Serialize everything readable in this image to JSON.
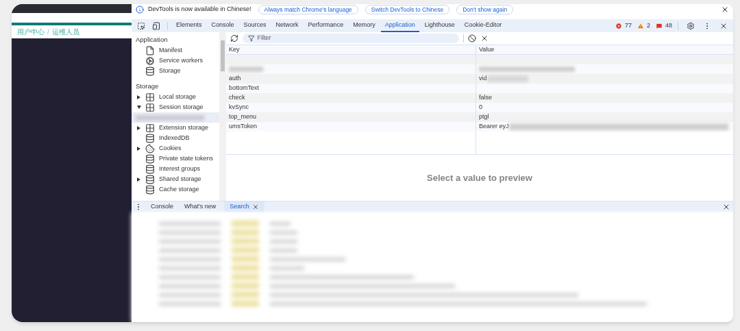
{
  "page": {
    "breadcrumb": [
      "用户中心",
      "运维人员"
    ],
    "separator": "/"
  },
  "infobar": {
    "message": "DevTools is now available in Chinese!",
    "buttons": [
      "Always match Chrome's language",
      "Switch DevTools to Chinese",
      "Don't show again"
    ]
  },
  "tabs": [
    {
      "label": "Elements",
      "selected": false
    },
    {
      "label": "Console",
      "selected": false
    },
    {
      "label": "Sources",
      "selected": false
    },
    {
      "label": "Network",
      "selected": false
    },
    {
      "label": "Performance",
      "selected": false
    },
    {
      "label": "Memory",
      "selected": false
    },
    {
      "label": "Application",
      "selected": true
    },
    {
      "label": "Lighthouse",
      "selected": false
    },
    {
      "label": "Cookie-Editor",
      "selected": false
    }
  ],
  "counts": {
    "errors": "77",
    "warnings": "2",
    "issues": "48"
  },
  "sidebar": {
    "sections": [
      {
        "title": "Application",
        "items": [
          {
            "label": "Manifest",
            "kind": "file"
          },
          {
            "label": "Service workers",
            "kind": "gears"
          },
          {
            "label": "Storage",
            "kind": "database"
          }
        ]
      },
      {
        "title": "Storage",
        "items": [
          {
            "label": "Local storage",
            "kind": "grid",
            "expanded": false
          },
          {
            "label": "Session storage",
            "kind": "grid",
            "expanded": true
          },
          {
            "kind": "blurred"
          },
          {
            "label": "Extension storage",
            "kind": "grid",
            "expanded": false
          },
          {
            "label": "IndexedDB",
            "kind": "database"
          },
          {
            "label": "Cookies",
            "kind": "cookie",
            "expanded": false
          },
          {
            "label": "Private state tokens",
            "kind": "database"
          },
          {
            "label": "Interest groups",
            "kind": "database"
          },
          {
            "label": "Shared storage",
            "kind": "database",
            "expanded": false
          },
          {
            "label": "Cache storage",
            "kind": "database"
          }
        ]
      }
    ]
  },
  "filter": {
    "placeholder": "Filter"
  },
  "table": {
    "columns": [
      "Key",
      "Value"
    ],
    "rows": [
      {
        "key": "",
        "value": "",
        "blurred": false
      },
      {
        "key": "",
        "value": "",
        "blurred": true
      },
      {
        "key": "auth",
        "value": "vid",
        "blurred": true
      },
      {
        "key": "bottomText",
        "value": "",
        "blurred": false
      },
      {
        "key": "check",
        "value": "false",
        "blurred": false
      },
      {
        "key": "kvSync",
        "value": "0",
        "blurred": false
      },
      {
        "key": "top_menu",
        "value": "ptgl",
        "blurred": false
      },
      {
        "key": "umsToken",
        "value": "Bearer eyJ",
        "blurred": true
      }
    ]
  },
  "preview": {
    "message": "Select a value to preview"
  },
  "drawer": {
    "tabs": [
      {
        "label": "Console",
        "selected": false,
        "closable": false
      },
      {
        "label": "What's new",
        "selected": false,
        "closable": false
      },
      {
        "label": "Search",
        "selected": true,
        "closable": true
      }
    ]
  }
}
